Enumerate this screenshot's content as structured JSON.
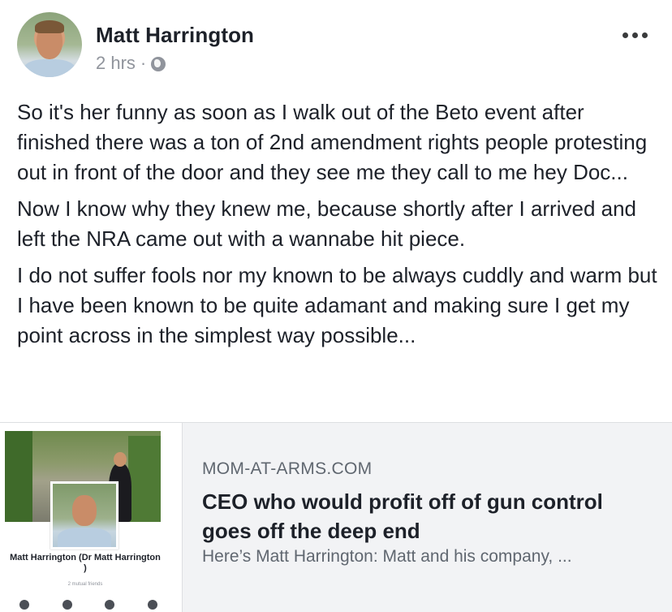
{
  "post": {
    "author": "Matt Harrington",
    "time": "2 hrs",
    "separator": "·",
    "privacy_icon": "globe-icon",
    "menu_icon": "more-options-icon",
    "paragraphs": [
      "So it's her funny as soon as I walk out of the Beto event after finished there was a ton of 2nd amendment rights people protesting out in front of the door and they see me they call to me hey Doc...",
      "Now I know why they knew me, because shortly after I arrived and left the NRA came out with a wannabe hit piece.",
      "I do not suffer fools nor my known to be always cuddly and warm but I have been known to be quite adamant and making sure I get my point across in the simplest way possible..."
    ]
  },
  "link_card": {
    "thumbnail": {
      "profile_name": "Matt Harrington (Dr Matt Harrington )",
      "mutual_friends": "2 mutual friends"
    },
    "domain": "MOM-AT-ARMS.COM",
    "headline": "CEO who would profit off of gun control goes off the deep end",
    "description": "Here’s Matt Harrington: Matt and his company, ..."
  },
  "colors": {
    "text_primary": "#1d2129",
    "text_secondary": "#90949c",
    "link_bg": "#f2f3f5"
  }
}
